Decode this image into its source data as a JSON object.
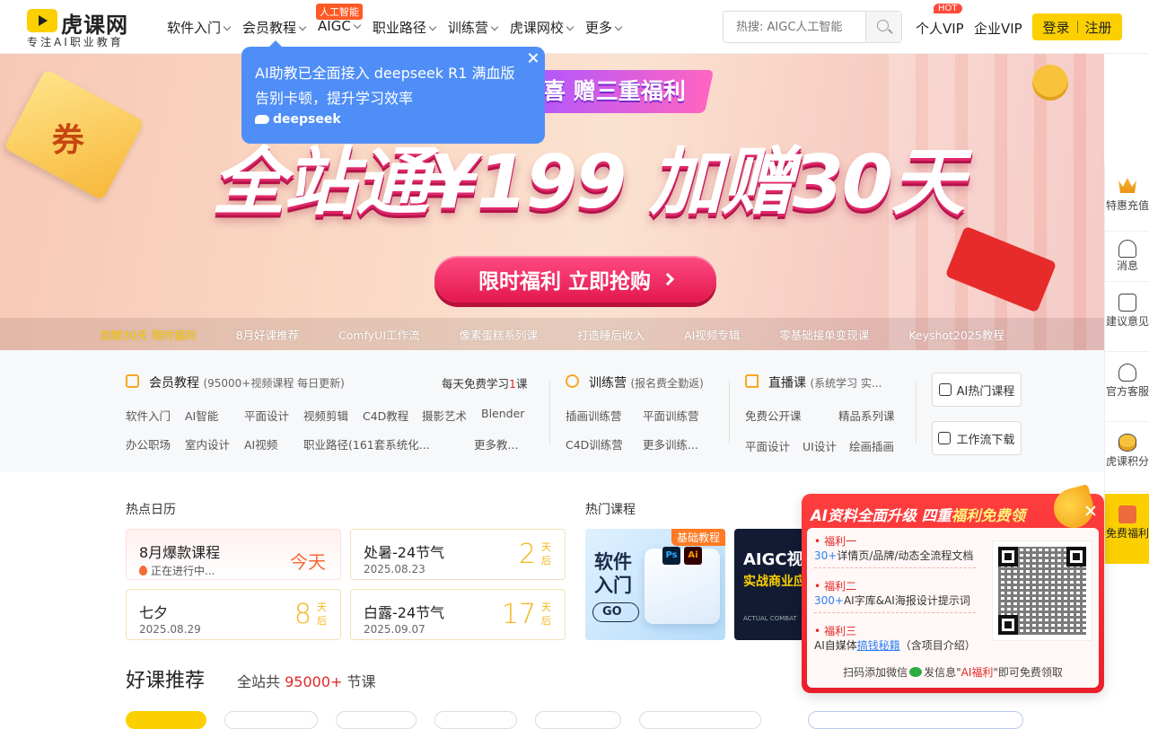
{
  "brand": {
    "name": "虎课网",
    "tagline": "专注AI职业教育"
  },
  "nav": {
    "items": [
      {
        "label": "软件入门"
      },
      {
        "label": "会员教程"
      },
      {
        "label": "AIGC"
      },
      {
        "label": "职业路径"
      },
      {
        "label": "训练营"
      },
      {
        "label": "虎课网校"
      },
      {
        "label": "更多"
      }
    ],
    "aigc_badge": "人工智能"
  },
  "search": {
    "placeholder": "热搜: AIGC人工智能"
  },
  "header": {
    "personal_vip": "个人VIP",
    "hot_badge": "HOT",
    "enterprise_vip": "企业VIP",
    "login": "登录",
    "register": "注册"
  },
  "tooltip": {
    "line1": "AI助教已全面接入 deepseek R1 满血版",
    "line2": "告别卡顿，提升学习效率",
    "logo_text": "deepseek"
  },
  "banner": {
    "coupon": "券",
    "ribbon": "喜 赠三重福利",
    "headline": "全站通¥199 加赠30天",
    "cta": "限时福利 立即抢购",
    "tabs": [
      "加赠30天 限时福利",
      "8月好课推荐",
      "ComfyUI工作流",
      "像素蛋糕系列课",
      "打造睡后收入",
      "AI视频专辑",
      "零基础接单变现课",
      "Keyshot2025教程"
    ]
  },
  "categories": {
    "member": {
      "title": "会员教程",
      "note": "(95000+视频课程 每日更新)",
      "free_pre": "每天免费学习",
      "free_num": "1",
      "free_post": "课",
      "links_row1": [
        "软件入门",
        "AI智能",
        "平面设计",
        "视频剪辑",
        "C4D教程",
        "摄影艺术",
        "Blender"
      ],
      "links_row2": [
        "办公职场",
        "室内设计",
        "AI视频",
        "职业路径(161套系统化...",
        "更多教..."
      ]
    },
    "camp": {
      "title": "训练营",
      "note": "(报名费全勤返)",
      "links_row1": [
        "插画训练营",
        "平面训练营"
      ],
      "links_row2": [
        "C4D训练营",
        "更多训练..."
      ]
    },
    "live": {
      "title": "直播课",
      "note": "(系统学习 实...",
      "links_row1": [
        "免费公开课",
        "精品系列课"
      ],
      "links_row2": [
        "平面设计",
        "UI设计",
        "绘画插画"
      ]
    },
    "buttons": [
      "AI热门课程",
      "工作流下载"
    ]
  },
  "calendar": {
    "title": "热点日历",
    "items": [
      {
        "name": "8月爆款课程",
        "status": "正在进行中...",
        "today": "今天"
      },
      {
        "name": "处暑-24节气",
        "date": "2025.08.23",
        "days": "2",
        "unit": "天后"
      },
      {
        "name": "七夕",
        "date": "2025.08.29",
        "days": "8",
        "unit": "天后"
      },
      {
        "name": "白露-24节气",
        "date": "2025.09.07",
        "days": "17",
        "unit": "天后"
      }
    ]
  },
  "hot_courses": {
    "title": "热门课程",
    "c1": {
      "tag": "基础教程",
      "title": "软件入门",
      "go": "GO",
      "app1": "Ps",
      "app2": "Ai"
    },
    "c2": {
      "title": "AIGC视",
      "sub": "实战商业应",
      "foot": "ACTUAL COMBAT"
    }
  },
  "good_courses": {
    "title": "好课推荐",
    "pre": "全站共",
    "count": "95000+",
    "post": "节课"
  },
  "sidebar": [
    {
      "label": "特惠充值",
      "icon": "crown-icon"
    },
    {
      "label": "消息",
      "icon": "bell-icon"
    },
    {
      "label": "建议意见",
      "icon": "feedback-icon"
    },
    {
      "label": "官方客服",
      "icon": "headset-icon"
    },
    {
      "label": "虎课积分",
      "icon": "coins-icon"
    },
    {
      "label": "免费福利",
      "icon": "gift-icon"
    }
  ],
  "popup": {
    "title_a": "AI资料全面升级 四重",
    "title_b": "福利免费领",
    "b1_title": "福利一",
    "b1_num": "30+",
    "b1_text": "详情页/品牌/动态全流程文档",
    "b2_title": "福利二",
    "b2_num": "300+",
    "b2_text": "AI字库&AI海报设计提示词",
    "b3_title": "福利三",
    "b3_pre": "AI自媒体",
    "b3_link": "搞钱秘籍",
    "b3_post": "（含项目介绍）",
    "foot_pre": "扫码添加微信",
    "foot_mid": "发信息\"",
    "foot_key": "AI福利",
    "foot_post": "\"即可免费领取"
  },
  "colors": {
    "brand_yellow": "#fcd000",
    "accent_red": "#e02828",
    "tooltip_blue": "#4f8ef7"
  }
}
